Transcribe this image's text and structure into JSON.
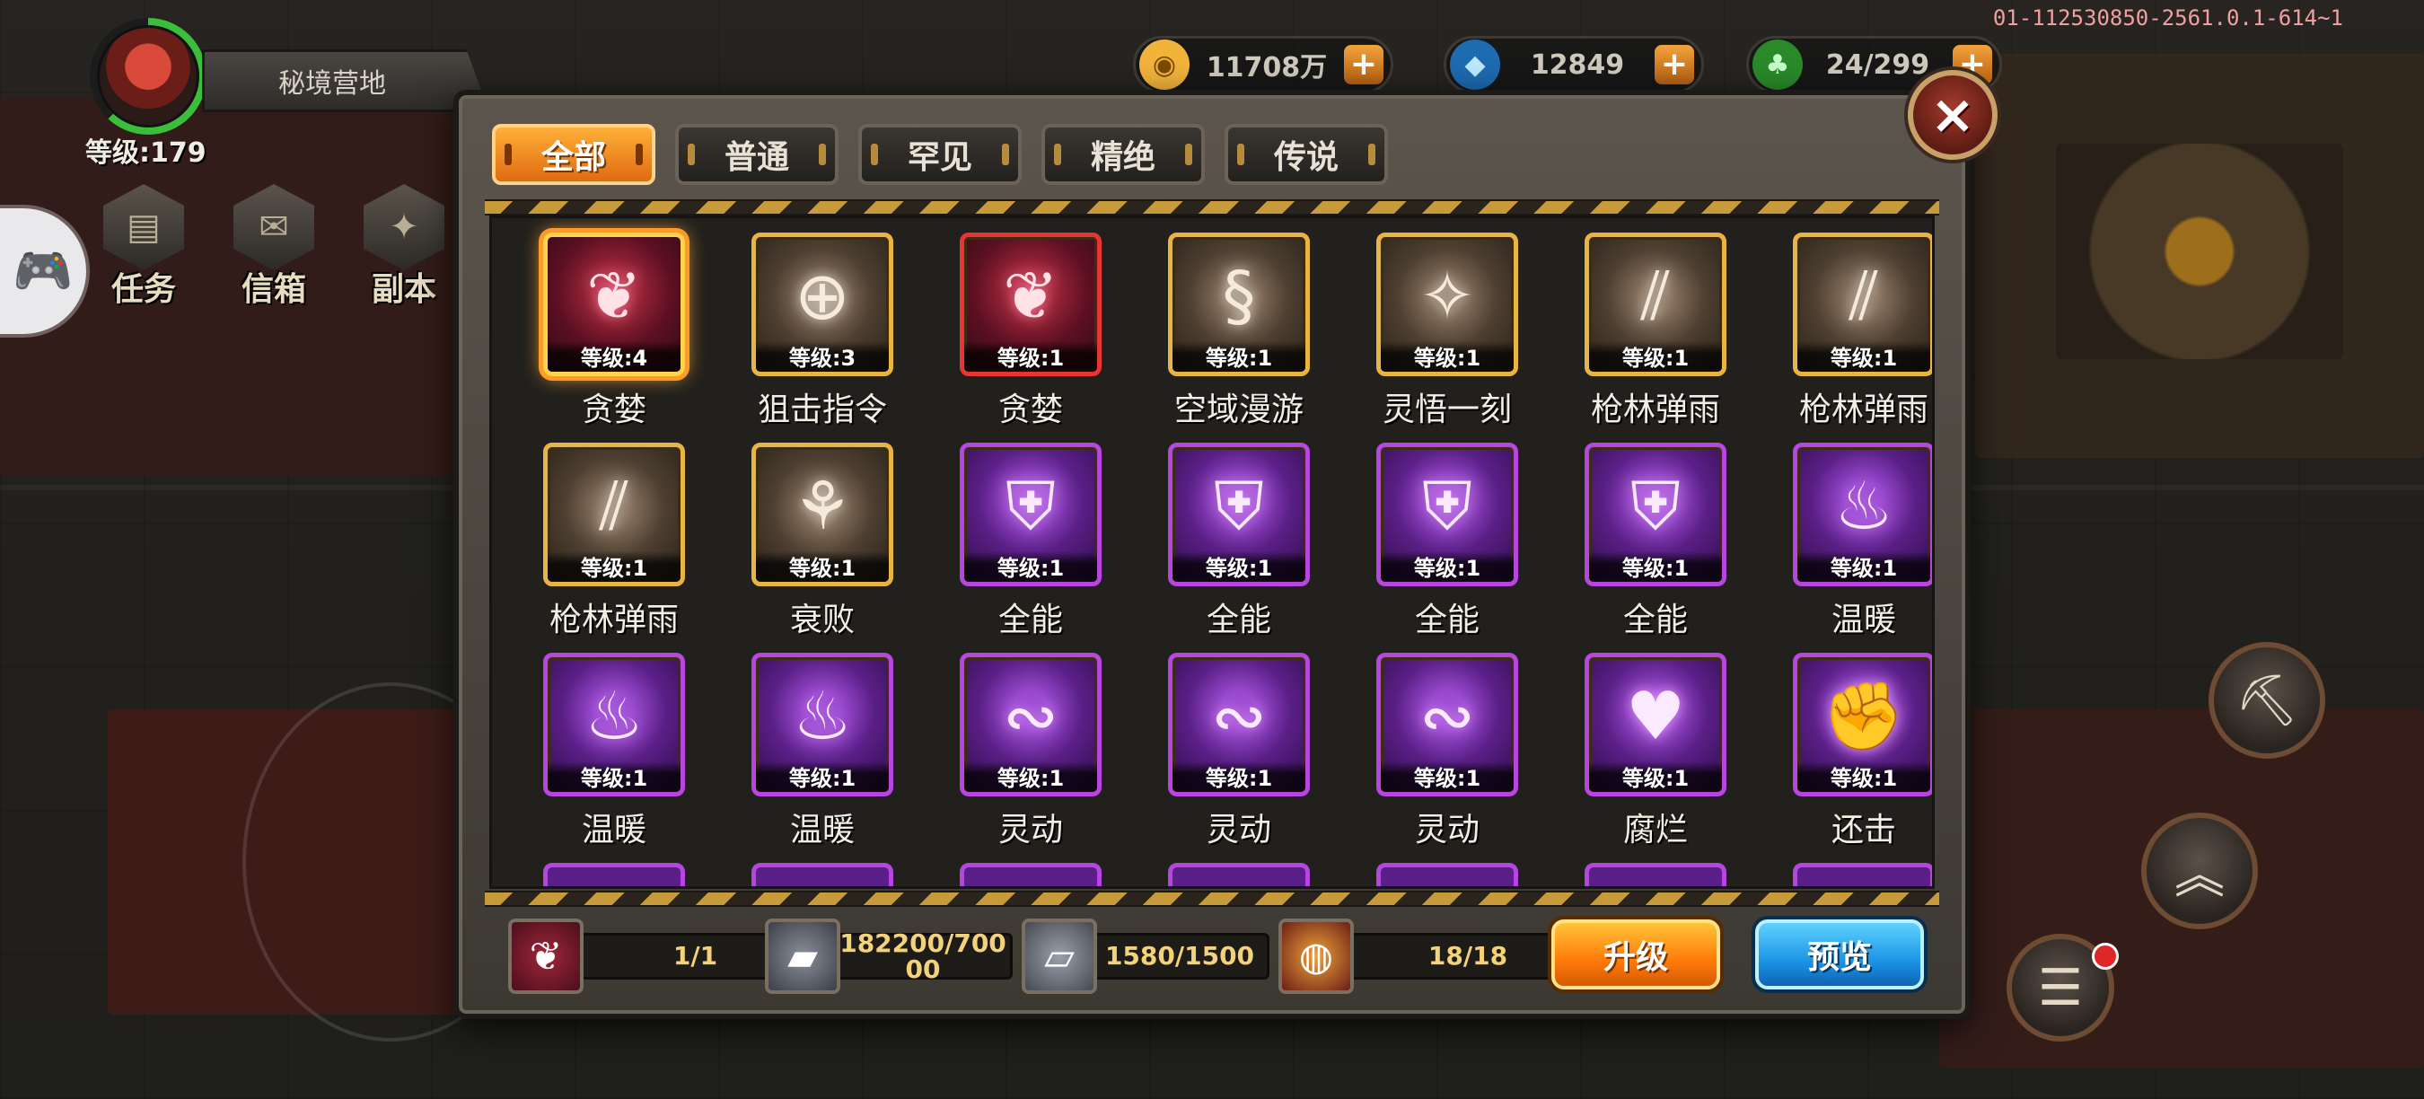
{
  "build_id": "01-112530850-2561.0.1-614~1",
  "player": {
    "location": "秘境营地",
    "level_label": "等级:179"
  },
  "side_menu": [
    {
      "label": "任务",
      "icon": "task-icon"
    },
    {
      "label": "信箱",
      "icon": "mail-icon"
    },
    {
      "label": "副本",
      "icon": "dungeon-icon"
    }
  ],
  "currencies": [
    {
      "name": "gold",
      "value": "11708万",
      "icon": "gold-coin-icon",
      "color": "#f2b33b"
    },
    {
      "name": "diamond",
      "value": "12849",
      "icon": "diamond-icon",
      "color": "#3fb8ff"
    },
    {
      "name": "energy",
      "value": "24/299",
      "icon": "energy-icon",
      "color": "#4ad44a"
    }
  ],
  "tabs": [
    {
      "label": "全部",
      "active": true
    },
    {
      "label": "普通",
      "active": false
    },
    {
      "label": "罕见",
      "active": false
    },
    {
      "label": "精绝",
      "active": false
    },
    {
      "label": "传说",
      "active": false
    }
  ],
  "skills": [
    {
      "name": "贪婪",
      "level": "等级:4",
      "rarity": "red",
      "selected": true,
      "icon": "greed-icon"
    },
    {
      "name": "狙击指令",
      "level": "等级:3",
      "rarity": "gold",
      "icon": "crosshair-icon"
    },
    {
      "name": "贪婪",
      "level": "等级:1",
      "rarity": "red",
      "icon": "greed-icon"
    },
    {
      "name": "空域漫游",
      "level": "等级:1",
      "rarity": "gold",
      "icon": "swirl-icon"
    },
    {
      "name": "灵悟一刻",
      "level": "等级:1",
      "rarity": "gold",
      "icon": "compass-star-icon"
    },
    {
      "name": "枪林弹雨",
      "level": "等级:1",
      "rarity": "gold",
      "icon": "bullet-rain-icon"
    },
    {
      "name": "枪林弹雨",
      "level": "等级:1",
      "rarity": "gold",
      "icon": "bullet-rain-icon"
    },
    {
      "name": "枪林弹雨",
      "level": "等级:1",
      "rarity": "gold",
      "icon": "bullet-rain-icon"
    },
    {
      "name": "衰败",
      "level": "等级:1",
      "rarity": "gold",
      "icon": "dead-tree-icon"
    },
    {
      "name": "全能",
      "level": "等级:1",
      "rarity": "purple",
      "icon": "armor-icon"
    },
    {
      "name": "全能",
      "level": "等级:1",
      "rarity": "purple",
      "icon": "armor-icon"
    },
    {
      "name": "全能",
      "level": "等级:1",
      "rarity": "purple",
      "icon": "armor-icon"
    },
    {
      "name": "全能",
      "level": "等级:1",
      "rarity": "purple",
      "icon": "armor-icon"
    },
    {
      "name": "温暖",
      "level": "等级:1",
      "rarity": "purple",
      "icon": "hot-cup-icon"
    },
    {
      "name": "温暖",
      "level": "等级:1",
      "rarity": "purple",
      "icon": "hot-cup-icon"
    },
    {
      "name": "温暖",
      "level": "等级:1",
      "rarity": "purple",
      "icon": "hot-cup-icon"
    },
    {
      "name": "灵动",
      "level": "等级:1",
      "rarity": "purple",
      "icon": "agility-swirl-icon"
    },
    {
      "name": "灵动",
      "level": "等级:1",
      "rarity": "purple",
      "icon": "agility-swirl-icon"
    },
    {
      "name": "灵动",
      "level": "等级:1",
      "rarity": "purple",
      "icon": "agility-swirl-icon"
    },
    {
      "name": "腐烂",
      "level": "等级:1",
      "rarity": "purple",
      "icon": "rotten-heart-icon"
    },
    {
      "name": "还击",
      "level": "等级:1",
      "rarity": "purple",
      "icon": "counter-fist-icon"
    }
  ],
  "resources": [
    {
      "icon": "greed-skill-icon",
      "value": "1/1"
    },
    {
      "icon": "gold-ingot-icon",
      "value": "182200/700\n00"
    },
    {
      "icon": "silver-ingot-icon",
      "value": "1580/1500"
    },
    {
      "icon": "core-orb-icon",
      "value": "18/18"
    }
  ],
  "buttons": {
    "upgrade": "升级",
    "preview": "预览"
  },
  "close_label": "×"
}
